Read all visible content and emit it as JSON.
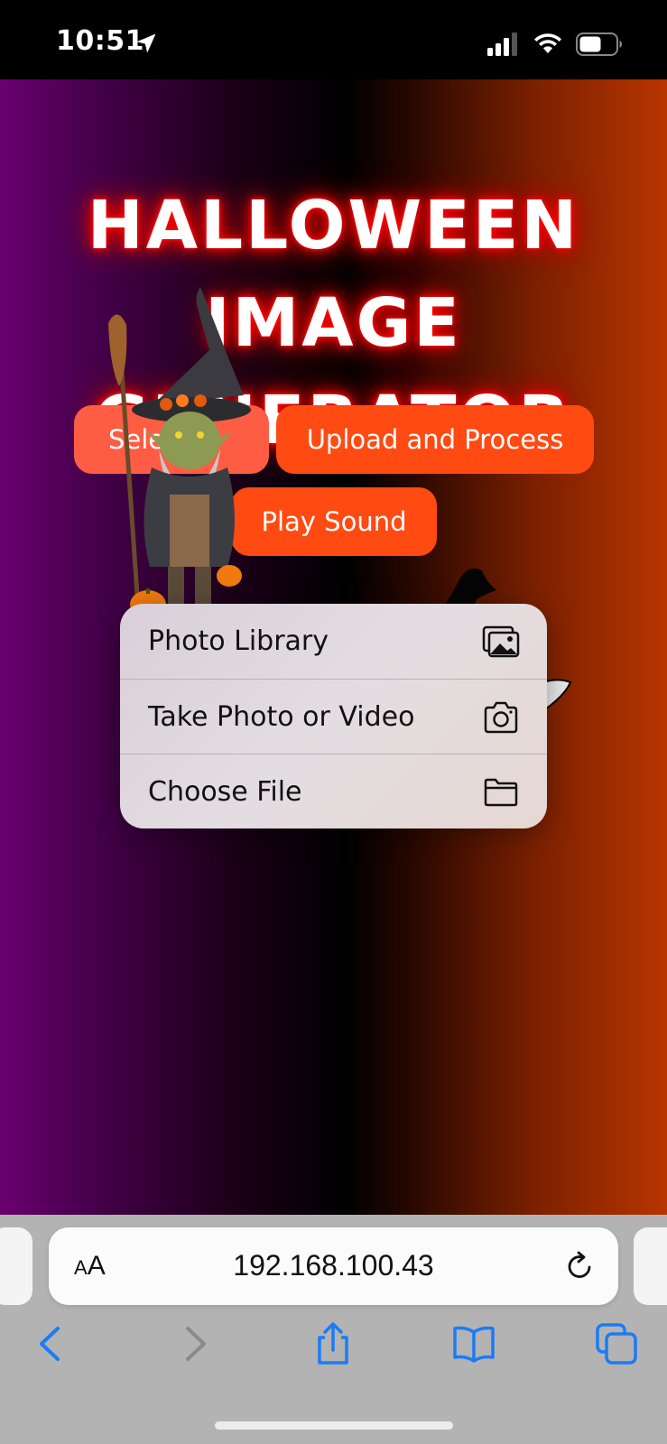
{
  "status_bar": {
    "time": "10:51",
    "icons": [
      "location-arrow-icon",
      "cellular-signal-icon",
      "wifi-icon",
      "battery-icon"
    ]
  },
  "page": {
    "title_line1": "HALLOWEEN IMAGE",
    "title_line2": "GENERATOR",
    "buttons": {
      "select_visible": "Sele",
      "upload": "Upload and Process",
      "play_sound": "Play Sound"
    },
    "colors": {
      "button_orange": "#ff4a12",
      "button_select": "#ff5d43",
      "title_glow": "#ff0000"
    }
  },
  "menu": {
    "items": [
      {
        "label": "Photo Library",
        "icon": "photo-library-icon"
      },
      {
        "label": "Take Photo or Video",
        "icon": "camera-icon"
      },
      {
        "label": "Choose File",
        "icon": "folder-icon"
      }
    ]
  },
  "safari": {
    "aa": "AA",
    "url": "192.168.100.43",
    "toolbar_icons": [
      "back-icon",
      "forward-icon",
      "share-icon",
      "bookmarks-icon",
      "tabs-icon"
    ],
    "accent": "#1a7cf5"
  }
}
